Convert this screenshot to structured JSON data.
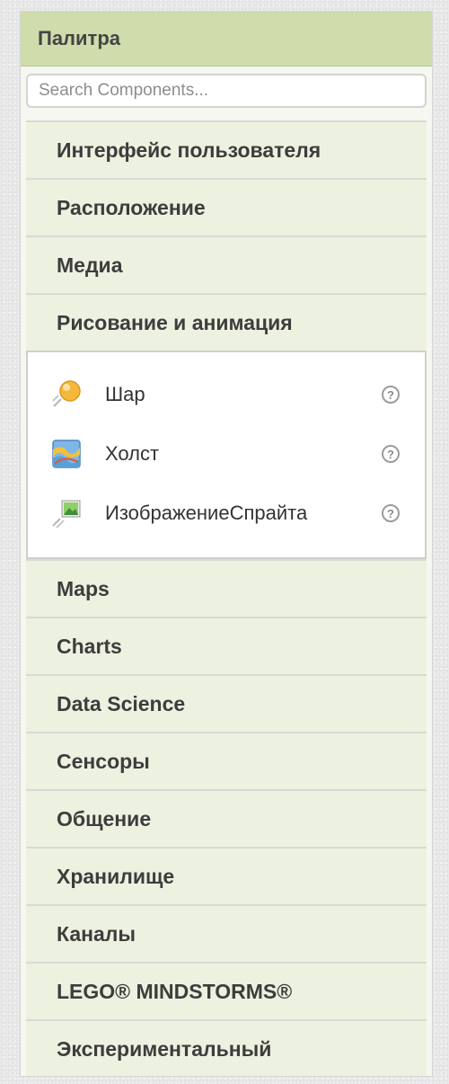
{
  "palette": {
    "title": "Палитра",
    "search": {
      "placeholder": "Search Components...",
      "value": ""
    },
    "categories_before": [
      {
        "label": "Интерфейс пользователя"
      },
      {
        "label": "Расположение"
      },
      {
        "label": "Медиа"
      }
    ],
    "open_category": {
      "label": "Рисование и анимация",
      "components": [
        {
          "label": "Шар",
          "icon": "ball-icon"
        },
        {
          "label": "Холст",
          "icon": "canvas-icon"
        },
        {
          "label": "ИзображениеСпрайта",
          "icon": "image-sprite-icon"
        }
      ],
      "help_glyph": "?"
    },
    "categories_after": [
      {
        "label": "Maps"
      },
      {
        "label": "Charts"
      },
      {
        "label": "Data Science"
      },
      {
        "label": "Сенсоры"
      },
      {
        "label": "Общение"
      },
      {
        "label": "Хранилище"
      },
      {
        "label": "Каналы"
      },
      {
        "label": "LEGO® MINDSTORMS®"
      },
      {
        "label": "Экспериментальный"
      }
    ]
  },
  "colors": {
    "header_bg": "#cfdcac",
    "category_bg": "#edf1e0",
    "panel_bg": "#f6f7f0"
  }
}
